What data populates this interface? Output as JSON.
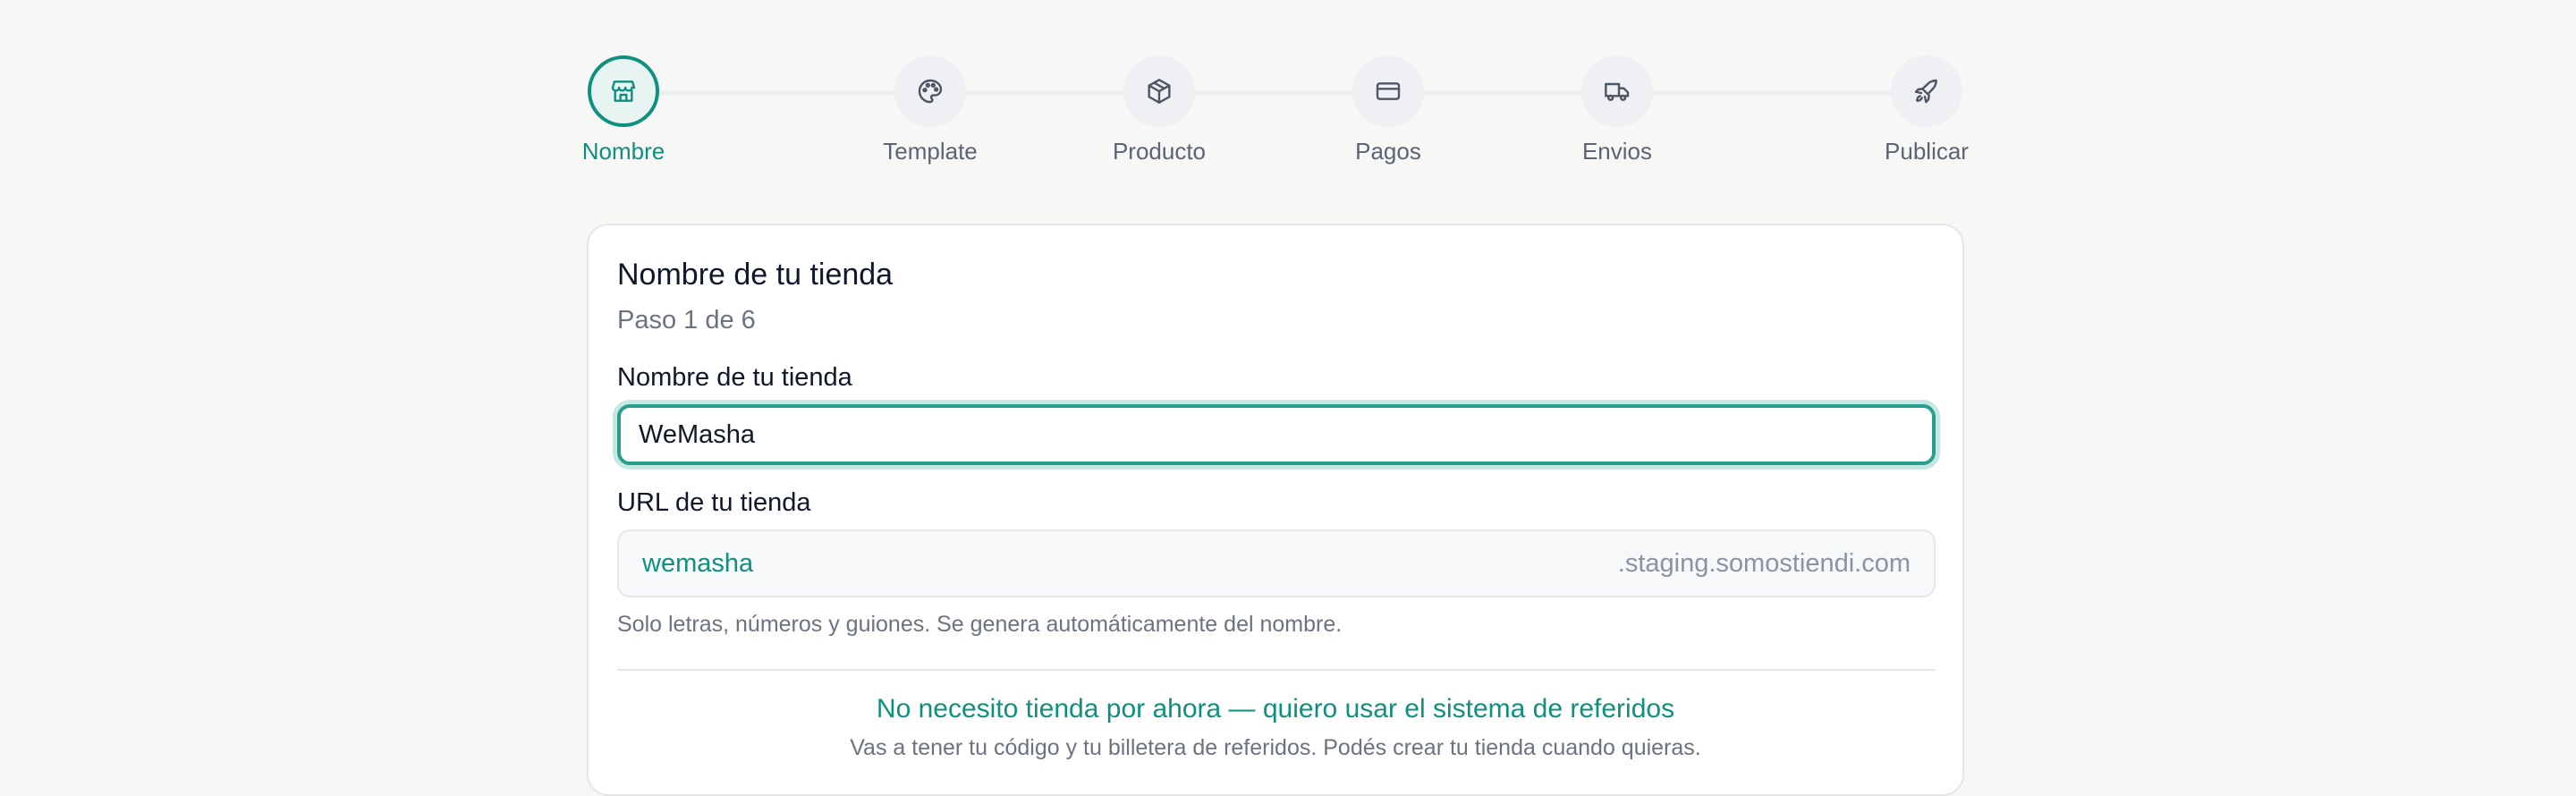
{
  "stepper": {
    "steps": [
      {
        "label": "Nombre",
        "icon": "store-icon",
        "active": true
      },
      {
        "label": "Template",
        "icon": "palette-icon",
        "active": false
      },
      {
        "label": "Producto",
        "icon": "package-icon",
        "active": false
      },
      {
        "label": "Pagos",
        "icon": "credit-card-icon",
        "active": false
      },
      {
        "label": "Envios",
        "icon": "truck-icon",
        "active": false
      },
      {
        "label": "Publicar",
        "icon": "rocket-icon",
        "active": false
      }
    ]
  },
  "form": {
    "title": "Nombre de tu tienda",
    "subtitle": "Paso 1 de 6",
    "name_label": "Nombre de tu tienda",
    "name_value": "WeMasha",
    "url_label": "URL de tu tienda",
    "url_slug": "wemasha",
    "url_suffix": ".staging.somostiendi.com",
    "url_help": "Solo letras, números y guiones. Se genera automáticamente del nombre."
  },
  "referral": {
    "link_text": "No necesito tienda por ahora — quiero usar el sistema de referidos",
    "note": "Vas a tener tu código y tu billetera de referidos. Podés crear tu tienda cuando quieras."
  },
  "colors": {
    "accent": "#0f8f7e",
    "background": "#f7f7f6",
    "muted_text": "#6b7280"
  }
}
